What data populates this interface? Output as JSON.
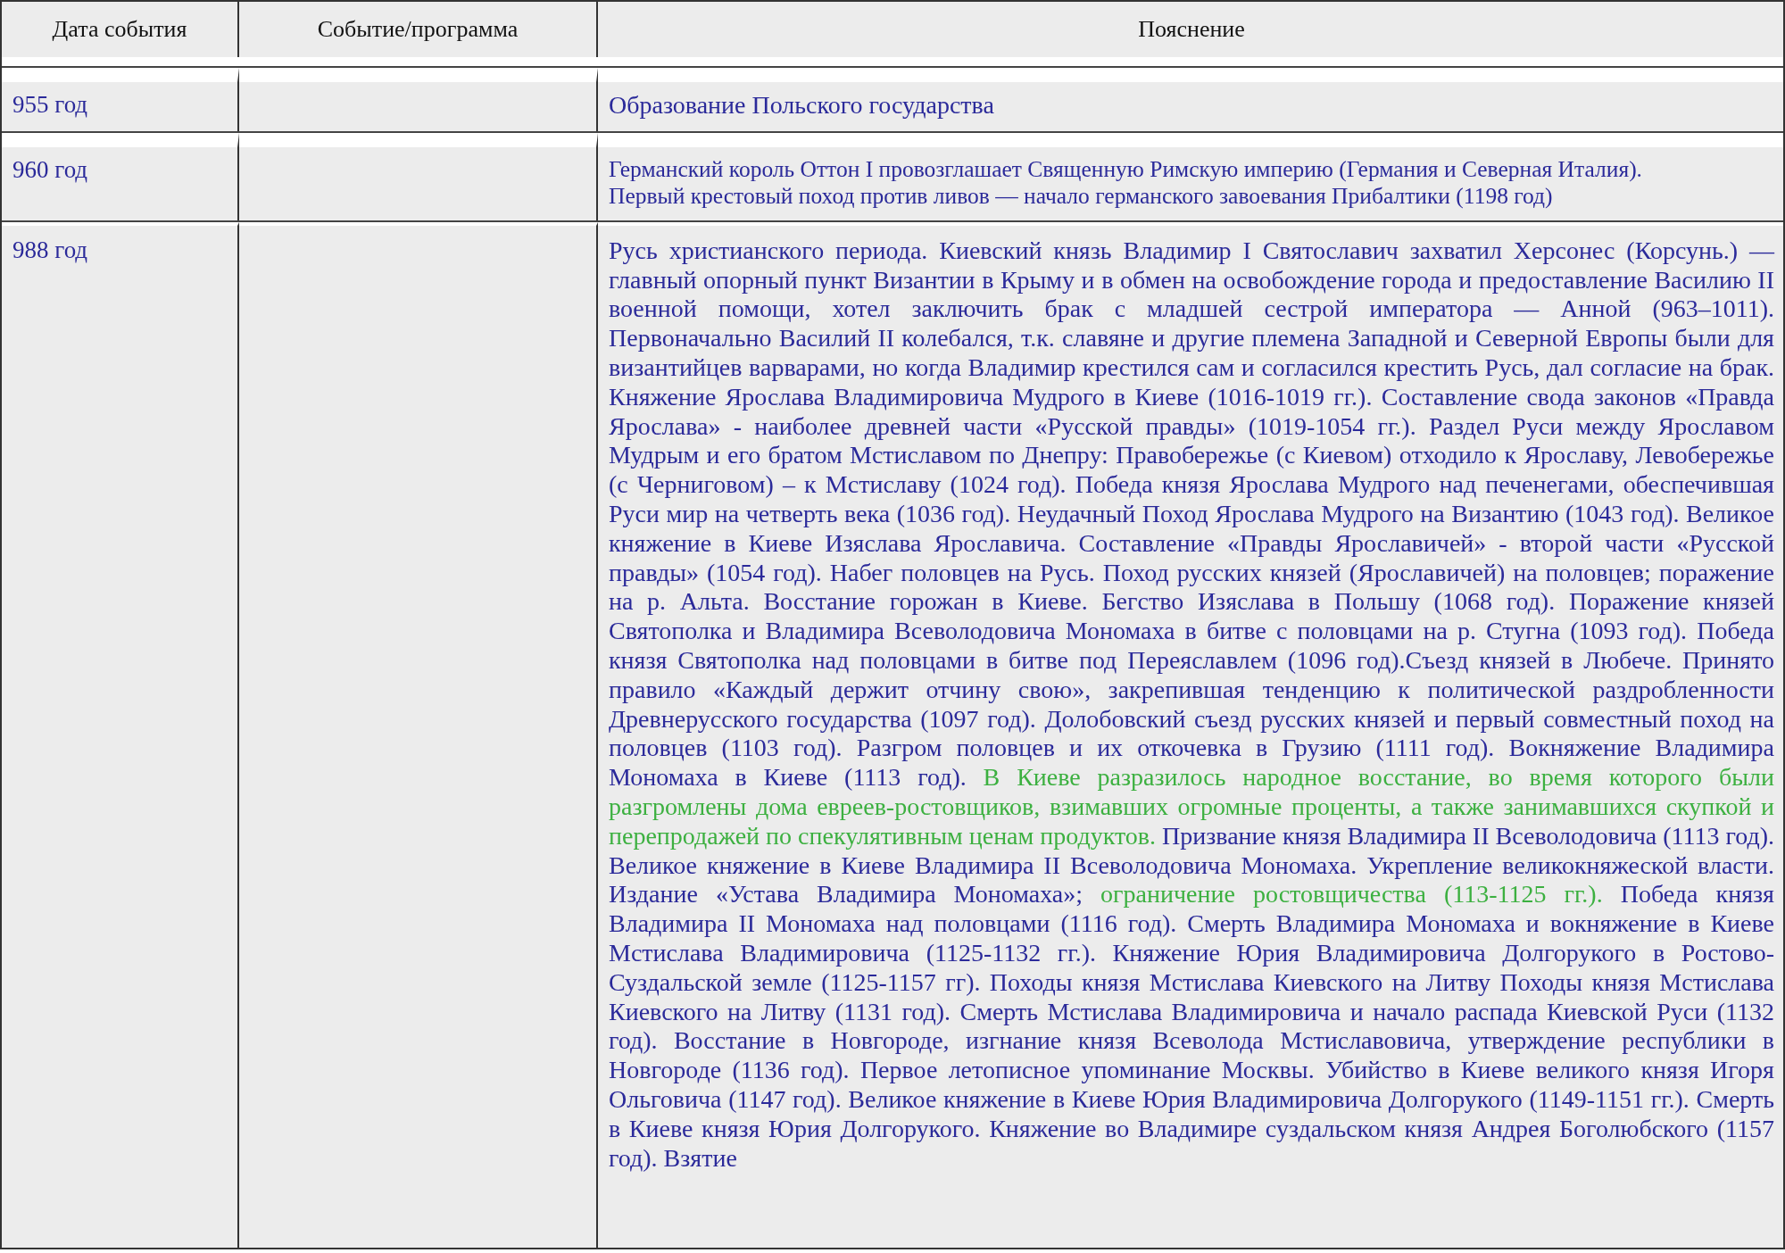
{
  "table": {
    "columns": [
      "Дата события",
      "Событие/программа",
      "Пояснение"
    ],
    "rows": [
      {
        "date": "955 год",
        "paragraphs": [
          {
            "segments": [
              {
                "text": "Образование Польского государства",
                "highlighted": false
              }
            ]
          }
        ]
      },
      {
        "date": "960 год",
        "paragraphs": [
          {
            "segments": [
              {
                "text": "Германский король Оттон I провозглашает Священную Римскую империю (Германия и Северная Италия).",
                "highlighted": false
              }
            ]
          },
          {
            "segments": [
              {
                "text": "Первый крестовый поход против ливов — начало германского завоевания Прибалтики (1198 год)",
                "highlighted": false
              }
            ]
          }
        ]
      },
      {
        "date": "988 год",
        "paragraphs": [
          {
            "segments": [
              {
                "text": "Русь христианского периода. Киевский князь Владимир I Святославич захватил Херсонес (Корсунь.) — главный опорный пункт Византии в Крыму и в обмен на освобождение города и предоставление Василию II военной помощи, хотел заключить брак с младшей сестрой императора — Анной (963–1011). Первоначально Василий II колебался, т.к. славяне и другие племена Западной и Северной Европы были для византийцев варварами, но когда Владимир крестился сам и согласился крестить Русь, дал согласие на брак. Княжение Ярослава Владимировича Мудрого в Киеве (1016-1019 гг.). Составление свода законов «Правда Ярослава» - наиболее древней части «Русской правды» (1019-1054 гг.). Раздел Руси между Ярославом Мудрым и его братом Мстиславом по Днепру: Правобережье (с Киевом) отходило к Ярославу, Левобережье (с Черниговом) – к Мстиславу (1024 год). Победа князя Ярослава Мудрого над печенегами, обеспечившая Руси мир на четверть века (1036 год). Неудачный Поход Ярослава Мудрого на Византию (1043 год). Великое княжение в Киеве Изяслава Ярославича. Составление «Правды Ярославичей» - второй части «Русской правды» (1054 год). Набег половцев на Русь. Поход русских князей (Ярославичей) на половцев; поражение на р. Альта. Восстание горожан в Киеве. Бегство Изяслава в Польшу (1068 год). Поражение князей Святополка и Владимира Всеволодовича Мономаха в битве с половцами на р. Стугна (1093 год). Победа князя Святополка над половцами в битве под Переяславлем (1096 год).Съезд князей в Любече. Принято правило «Каждый держит отчину свою», закрепившая тенденцию к политической раздробленности Древнерусского государства (1097 год). Долобовский съезд русских князей и первый совместный поход на половцев (1103 год). Разгром половцев и их откочевка в Грузию (1111 год). Вокняжение Владимира Мономаха в Киеве (1113 год). ",
                "highlighted": false
              },
              {
                "text": "В Киеве разразилось народное восстание, во время которого были разгромлены дома евреев-ростовщиков, взимавших огромные проценты, а также занимавшихся скупкой и перепродажей по спекулятивным ценам продуктов.",
                "highlighted": true
              },
              {
                "text": " Призвание князя Владимира II Всеволодовича (1113 год). Великое княжение в Киеве Владимира II Всеволодовича Мономаха. Укрепление великокняжеской власти. Издание «Устава Владимира Мономаха»; ",
                "highlighted": false
              },
              {
                "text": "ограничение ростовщичества (113-1125 гг.).",
                "highlighted": true
              },
              {
                "text": " Победа князя Владимира II Мономаха над половцами (1116 год). Смерть Владимира Мономаха и вокняжение в Киеве Мстислава Владимировича (1125-1132 гг.). Княжение Юрия Владимировича Долгорукого в Ростово-Суздальской земле (1125-1157 гг). Походы князя Мстислава Киевского на Литву Походы князя Мстислава Киевского на Литву (1131 год). Смерть Мстислава Владимировича и начало распада Киевской Руси (1132 год). Восстание в Новгороде, изгнание князя Всеволода Мстиславовича, утверждение республики в Новгороде (1136 год). Первое летописное упоминание Москвы. Убийство в Киеве великого князя Игоря Ольговича (1147 год). Великое княжение в Киеве Юрия Владимировича Долгорукого (1149-1151 гг.). Смерть в Киеве князя Юрия Долгорукого. Княжение во Владимире суздальском князя Андрея Боголюбского (1157 год). Взятие",
                "highlighted": false
              }
            ]
          }
        ]
      }
    ]
  }
}
